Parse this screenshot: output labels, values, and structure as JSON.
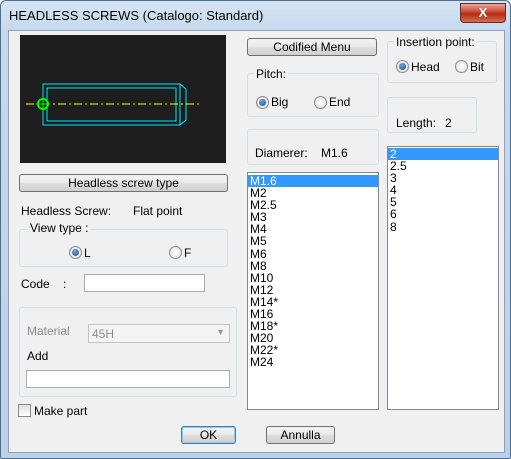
{
  "window": {
    "title": "HEADLESS SCREWS (Catalogo: Standard)",
    "close_glyph": "X"
  },
  "buttons": {
    "codified_menu": "Codified Menu",
    "headless_screw_type": "Headless screw type",
    "ok": "OK",
    "cancel": "Annulla"
  },
  "pitch": {
    "label": "Pitch:",
    "options": [
      {
        "label": "Big",
        "selected": true
      },
      {
        "label": "End",
        "selected": false
      }
    ]
  },
  "insertion_point": {
    "label": "Insertion point:",
    "options": [
      {
        "label": "Head",
        "selected": true
      },
      {
        "label": "Bit",
        "selected": false
      }
    ]
  },
  "length": {
    "label": "Length:",
    "value": "2"
  },
  "diameter": {
    "label": "Diamerer:",
    "value": "M1.6"
  },
  "info": {
    "label": "Headless Screw:",
    "value": "Flat point"
  },
  "view_type": {
    "label": "View type  :",
    "options": [
      {
        "label": "L",
        "selected": true
      },
      {
        "label": "F",
        "selected": false
      }
    ]
  },
  "code": {
    "label": "Code    :",
    "value": ""
  },
  "material": {
    "label": "Material",
    "value": "45H"
  },
  "add": {
    "label": "Add",
    "value": ""
  },
  "make_part": {
    "label": "Make part",
    "checked": false
  },
  "diameter_list": [
    "M1.6",
    "M2",
    "M2.5",
    "M3",
    "M4",
    "M5",
    "M6",
    "M8",
    "M10",
    "M12",
    "M14*",
    "M16",
    "M18*",
    "M20",
    "M22*",
    "M24"
  ],
  "diameter_selected_index": 0,
  "length_list": [
    "2",
    "2.5",
    "3",
    "4",
    "5",
    "6",
    "8"
  ],
  "length_selected_index": 0,
  "colors": {
    "preview_bg": "#1e1e1e",
    "outline": "#00e5ff",
    "axis": "#ffff00",
    "point": "#00ff00",
    "selection": "#3399ff"
  }
}
